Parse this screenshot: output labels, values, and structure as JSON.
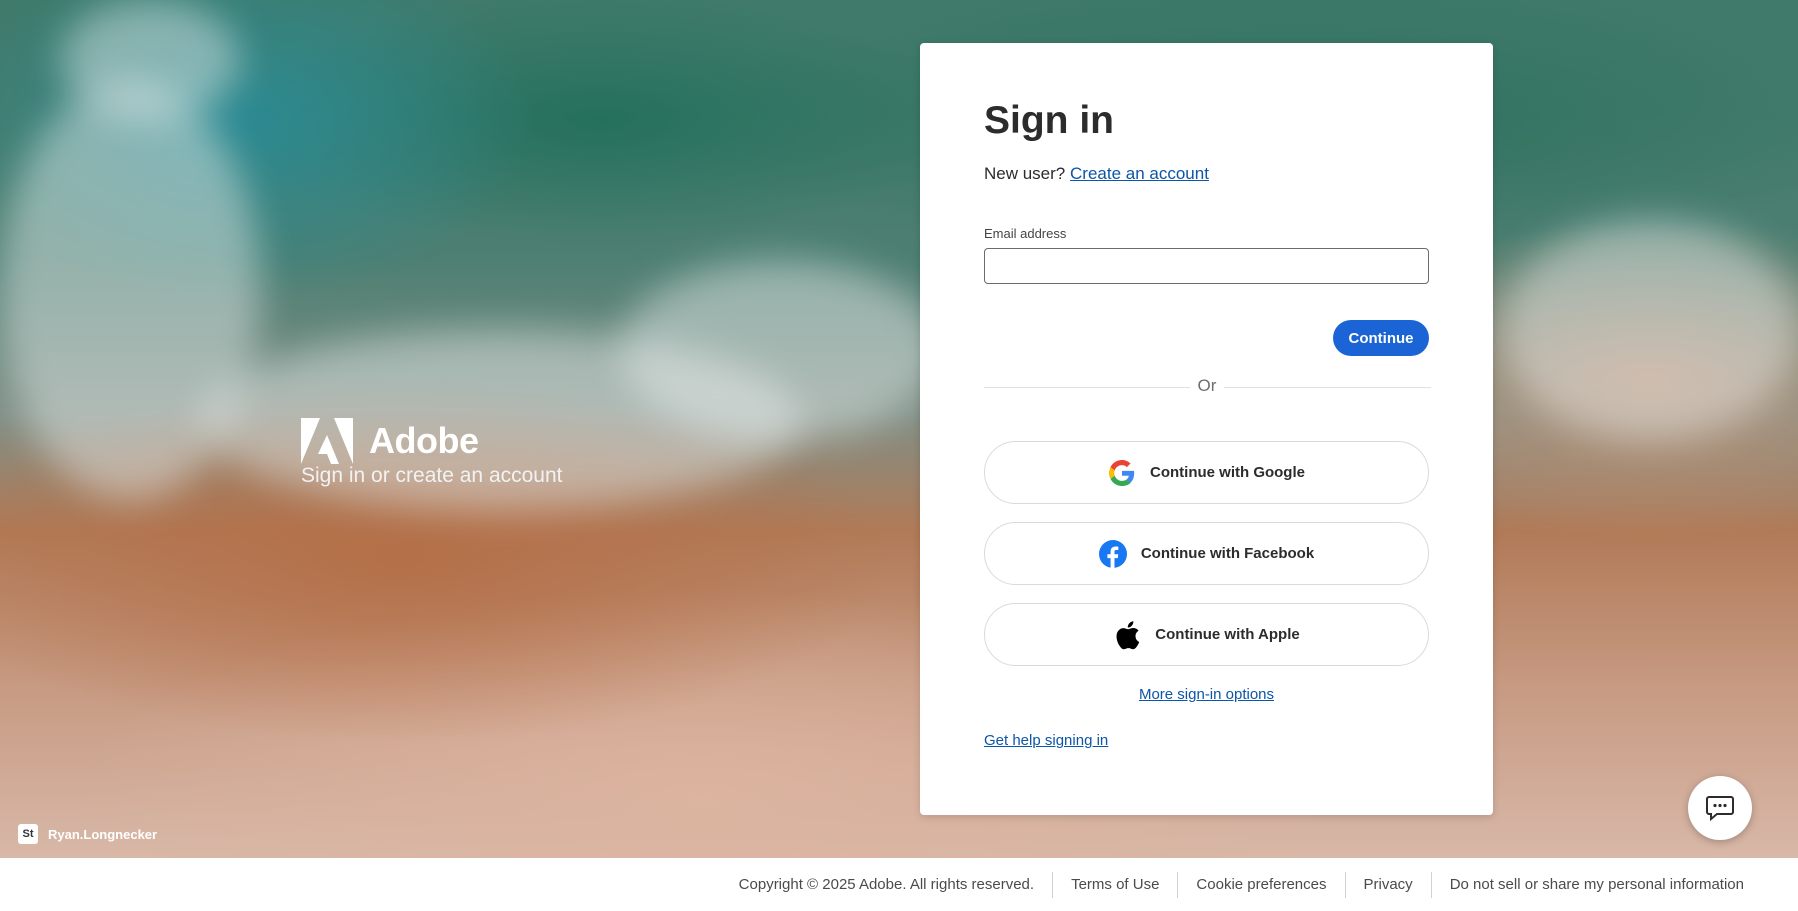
{
  "brand": {
    "name": "Adobe",
    "tagline": "Sign in or create an account"
  },
  "credit": {
    "badge": "St",
    "name": "Ryan.Longnecker"
  },
  "card": {
    "title": "Sign in",
    "new_user_prefix": "New user?",
    "create_account_link": "Create an account",
    "email_label": "Email address",
    "email_value": "",
    "continue_label": "Continue",
    "or_label": "Or",
    "google_label": "Continue with Google",
    "facebook_label": "Continue with Facebook",
    "apple_label": "Continue with Apple",
    "more_options_link": "More sign-in options",
    "help_link": "Get help signing in"
  },
  "footer": {
    "copyright": "Copyright © 2025 Adobe. All rights reserved.",
    "links": [
      "Terms of Use",
      "Cookie preferences",
      "Privacy",
      "Do not sell or share my personal information"
    ]
  },
  "colors": {
    "accent": "#1a64d6",
    "link": "#0d55a7",
    "facebook": "#1877f2"
  },
  "icons": {
    "brand": "adobe-logo-icon",
    "google": "google-icon",
    "facebook": "facebook-icon",
    "apple": "apple-icon",
    "chat": "chat-bubble-icon"
  }
}
